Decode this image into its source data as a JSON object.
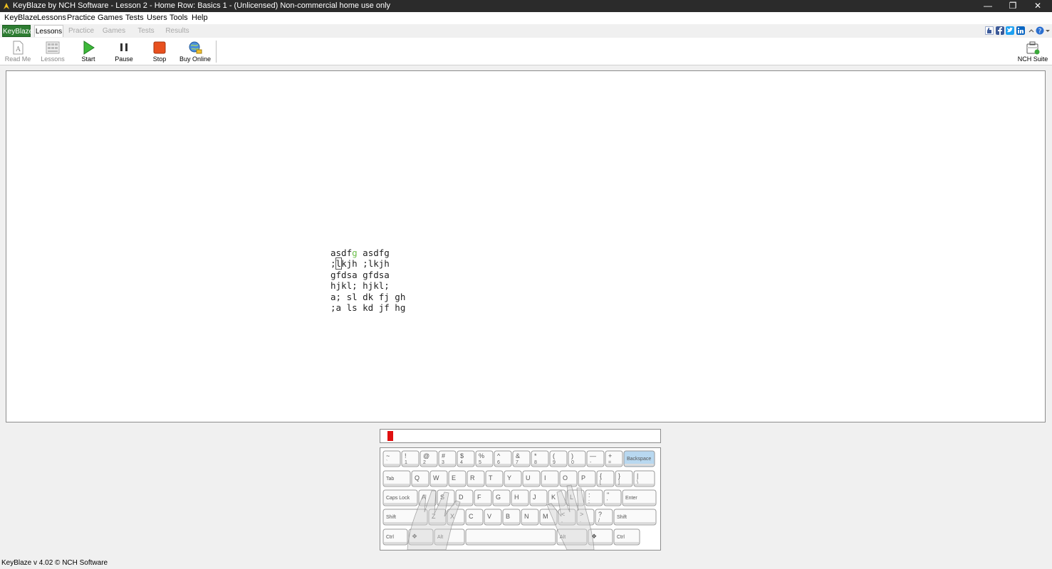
{
  "window": {
    "title": "KeyBlaze by NCH Software - Lesson 2 - Home Row: Basics 1 - (Unlicensed) Non-commercial home use only",
    "minimize_glyph": "—",
    "maximize_glyph": "❐",
    "close_glyph": "✕"
  },
  "menu": [
    "KeyBlaze",
    "Lessons",
    "Practice",
    "Games",
    "Tests",
    "Users",
    "Tools",
    "Help"
  ],
  "tabs": {
    "keyblaze": "KeyBlaze",
    "lessons": "Lessons",
    "practice": "Practice",
    "games": "Games",
    "tests": "Tests",
    "results": "Results"
  },
  "social_icons": [
    "thumbs-up-icon",
    "facebook-icon",
    "twitter-icon",
    "linkedin-icon",
    "help-icon"
  ],
  "toolbar": {
    "read_me": "Read Me",
    "lessons": "Lessons",
    "start": "Start",
    "pause": "Pause",
    "stop": "Stop",
    "buy_online": "Buy Online",
    "nch_suite": "NCH Suite"
  },
  "lesson": {
    "line1": {
      "pre": "asdf",
      "typed": "g",
      "post": " asdfg"
    },
    "line2": {
      "pre": ";",
      "current": "l",
      "post": "kjh ;lkjh"
    },
    "line3": "gfdsa gfdsa",
    "line4": "hjkl; hjkl;",
    "line5": "a; sl dk fj gh",
    "line6": ";a ls kd jf hg"
  },
  "colors": {
    "typed_correct": "#6cbf4a",
    "error_caret": "#e01010",
    "highlight_key": "#b8d8f0",
    "keyblaze_tab": "#2e7d32"
  },
  "keyboard": {
    "highlighted_key": "Backspace",
    "row1": [
      [
        "~",
        "`"
      ],
      [
        "!",
        "1"
      ],
      [
        "@",
        "2"
      ],
      [
        "#",
        "3"
      ],
      [
        "$",
        "4"
      ],
      [
        "%",
        "5"
      ],
      [
        "^",
        "6"
      ],
      [
        "&",
        "7"
      ],
      [
        "*",
        "8"
      ],
      [
        "(",
        "9"
      ],
      [
        ")",
        "0"
      ],
      [
        "—",
        "-"
      ],
      [
        "+",
        "="
      ]
    ],
    "row2": [
      "Q",
      "W",
      "E",
      "R",
      "T",
      "Y",
      "U",
      "I",
      "O",
      "P",
      [
        "{",
        "["
      ],
      [
        "}",
        "]"
      ],
      [
        "|",
        "\\"
      ]
    ],
    "row3": [
      "A",
      "S",
      "D",
      "F",
      "G",
      "H",
      "J",
      "K",
      "L",
      [
        ":",
        ";"
      ],
      [
        "\"",
        "'"
      ]
    ],
    "row4": [
      "Z",
      "X",
      "C",
      "V",
      "B",
      "N",
      "M",
      [
        "<",
        ","
      ],
      [
        ">",
        "."
      ],
      [
        "?",
        "/"
      ]
    ],
    "labels": {
      "backspace": "Backspace",
      "tab": "Tab",
      "caps": "Caps Lock",
      "enter": "Enter",
      "shift": "Shift",
      "ctrl": "Ctrl",
      "alt": "Alt"
    }
  },
  "status": "KeyBlaze v 4.02 © NCH Software"
}
